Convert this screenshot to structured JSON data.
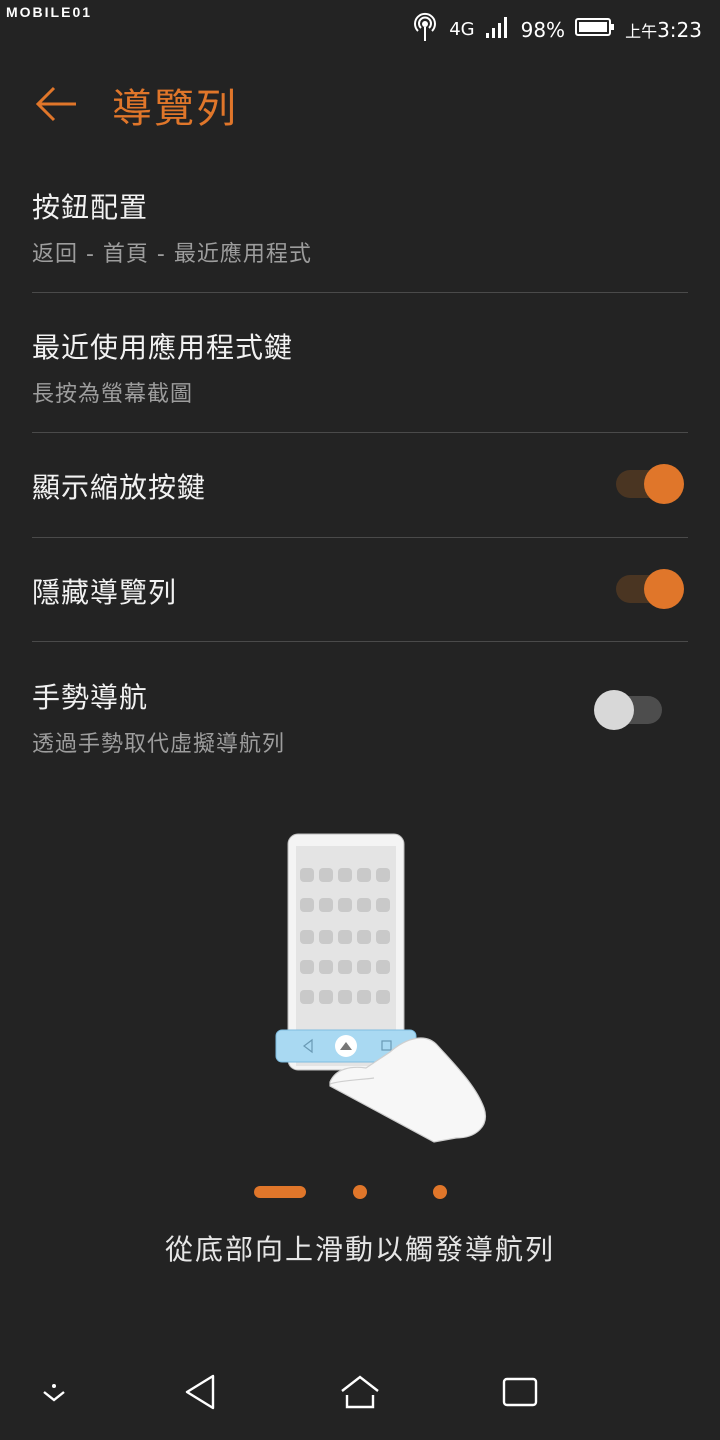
{
  "status_bar": {
    "watermark": "MOBILE01",
    "network": "4G",
    "battery": "98%",
    "time_prefix": "上午",
    "time": "3:23"
  },
  "header": {
    "title": "導覽列"
  },
  "settings": [
    {
      "label": "按鈕配置",
      "sub": "返回 - 首頁 - 最近應用程式"
    },
    {
      "label": "最近使用應用程式鍵",
      "sub": "長按為螢幕截圖"
    },
    {
      "label": "顯示縮放按鍵",
      "toggle": true
    },
    {
      "label": "隱藏導覽列",
      "toggle": true
    },
    {
      "label": "手勢導航",
      "sub": "透過手勢取代虛擬導航列",
      "toggle": false
    }
  ],
  "tutorial": {
    "caption": "從底部向上滑動以觸發導航列",
    "page_count": 3,
    "active_page": 1
  },
  "colors": {
    "accent": "#e0762a",
    "background": "#232323"
  },
  "nav_icons": [
    "expand-icon",
    "back-icon",
    "home-icon",
    "recents-icon"
  ]
}
